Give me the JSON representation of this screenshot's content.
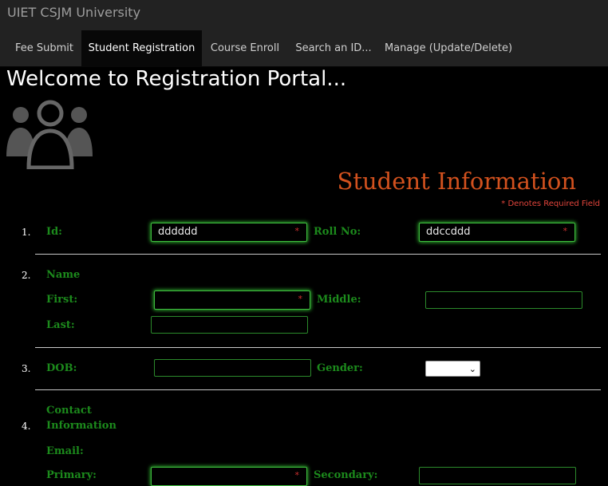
{
  "app": {
    "title": "UIET CSJM University"
  },
  "tabs": [
    {
      "label": "Fee Submit"
    },
    {
      "label": "Student Registration"
    },
    {
      "label": "Course Enroll"
    },
    {
      "label": "Search an ID..."
    },
    {
      "label": "Manage (Update/Delete)"
    }
  ],
  "active_tab": "Student Registration",
  "page": {
    "welcome": "Welcome to Registration Portal..."
  },
  "section": {
    "title": "Student Information",
    "required_note": "* Denotes Required Field"
  },
  "form": {
    "rows": {
      "r1": {
        "num": "1.",
        "id_label": "Id:",
        "id_value": "dddddd",
        "roll_label": "Roll No:",
        "roll_value": "ddccddd"
      },
      "r2": {
        "num": "2.",
        "group_label": "Name",
        "first_label": "First:",
        "middle_label": "Middle:",
        "last_label": "Last:"
      },
      "r3": {
        "num": "3.",
        "dob_label": "DOB:",
        "gender_label": "Gender:"
      },
      "r4": {
        "num": "4.",
        "group_label_line1": "Contact",
        "group_label_line2": "Information",
        "email_label": "Email:",
        "primary_label": "Primary:",
        "secondary_label": "Secondary:"
      }
    },
    "required_mark": "*"
  },
  "colors": {
    "label": "#1c8a1c",
    "section_title": "#d2511e",
    "required": "#e0443b"
  }
}
